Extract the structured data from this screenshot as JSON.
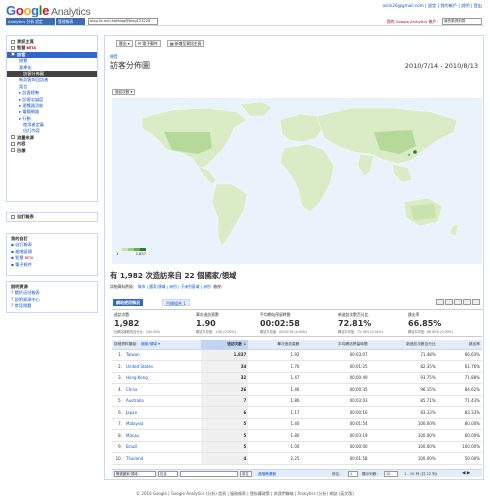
{
  "header": {
    "logo_letters": [
      "G",
      "o",
      "o",
      "g",
      "l",
      "e"
    ],
    "logo_suffix": "Analytics",
    "top_links": "aslin26@gmail.com | 設定 | 我的帳戶 | 說明 | 登出",
    "account_label": "Analytics 分析 設定",
    "account_label2": "管理報表",
    "profile_select": "blog.lic.edu.twfblog@blog123228",
    "right_account": "我的 Google Analytics 帳戶：",
    "right_select": "我的新資料財"
  },
  "sidebar": {
    "nav_items": [
      {
        "label": "資訊主頁",
        "style": "bold"
      },
      {
        "label": "智慧",
        "style": "bold",
        "badge": "BETA"
      },
      {
        "label": "訪客",
        "style": "active"
      },
      {
        "label": "總覽",
        "style": "sub"
      },
      {
        "label": "基準化",
        "style": "sub"
      },
      {
        "label": "訪客分佈圖",
        "style": "activesub"
      },
      {
        "label": "新訪客與回訪者",
        "style": "sub"
      },
      {
        "label": "語言",
        "style": "sub"
      },
      {
        "label": "▸ 訪客趨勢",
        "style": "sub"
      },
      {
        "label": "▸ 訪客忠誠度",
        "style": "sub"
      },
      {
        "label": "▸ 瀏覽器功能",
        "style": "sub"
      },
      {
        "label": "▸ 電腦網路",
        "style": "sub"
      },
      {
        "label": "▸ 行動",
        "style": "sub"
      },
      {
        "label": "使用者定義",
        "style": "sub2"
      },
      {
        "label": "自訂內容",
        "style": "sub2"
      },
      {
        "label": "流量來源",
        "style": "bold"
      },
      {
        "label": "內容",
        "style": "bold"
      },
      {
        "label": "目標",
        "style": "bold"
      }
    ],
    "custom_reports": "自訂報表",
    "my_custom_title": "我的自訂",
    "my_custom_items": [
      {
        "label": "自訂報表",
        "badge": ""
      },
      {
        "label": "進階區隔",
        "badge": ""
      },
      {
        "label": "智慧",
        "badge": "BETA"
      },
      {
        "label": "電子郵件",
        "badge": ""
      }
    ],
    "help_title": "說明資源",
    "help_items": [
      "關於這份報表",
      "說明資源中心",
      "常見問題"
    ]
  },
  "toolbar": {
    "export": "匯出 ▾",
    "email": "電子郵件",
    "add_to_dashboard": "新增至資訊主頁"
  },
  "main": {
    "breadcrumb": "總覽",
    "title": "訪客分佈圖",
    "date_range": "2010/7/14 - 2010/8/13",
    "map_tab": "造訪次數 ▾",
    "legend_min": "1",
    "legend_max": "1,837",
    "summary_prefix": "有 1,982 次造訪來自 22 個國家/領域",
    "dims_label": "詳細資料層級：",
    "dims_links": "城市 | 國家/領域 | 洲別 | 子洲別區域 | 洲別",
    "dims_view": "檢視：",
    "tab_site": "網站使用情況",
    "tab_goal": "目標組合 1"
  },
  "metrics": [
    {
      "label": "造訪次數",
      "value": "1,982",
      "sub": "佔網站總數的百分比：100.00%"
    },
    {
      "label": "單次造訪頁數",
      "value": "1.90",
      "sub": "網站平均值：1.90 (0.00%)"
    },
    {
      "label": "平均網站停留時間",
      "value": "00:02:58",
      "sub": "網站平均值：00:02:58 (0.00%)"
    },
    {
      "label": "新造訪次數百分比",
      "value": "72.81%",
      "sub": "網站平均值：72.78% (0.04%)"
    },
    {
      "label": "跳出率",
      "value": "66.85%",
      "sub": "網站平均值：66.85% (0.00%)"
    }
  ],
  "table": {
    "headers": [
      "詳細資料層級：",
      "國家/領域 ▾",
      "造訪次數 ↓",
      "單次造訪頁數",
      "平均網站停留時間",
      "新造訪次數百分比",
      "跳出率"
    ],
    "rows": [
      {
        "rank": "1.",
        "country": "Taiwan",
        "visits": "1,837",
        "ppv": "1.92",
        "time": "00:03:07",
        "newpct": "71.48%",
        "bounce": "66.63%"
      },
      {
        "rank": "2.",
        "country": "United States",
        "visits": "34",
        "ppv": "1.76",
        "time": "00:01:25",
        "newpct": "82.35%",
        "bounce": "61.76%"
      },
      {
        "rank": "3.",
        "country": "Hong Kong",
        "visits": "32",
        "ppv": "1.47",
        "time": "00:00:49",
        "newpct": "93.75%",
        "bounce": "71.88%"
      },
      {
        "rank": "4.",
        "country": "China",
        "visits": "26",
        "ppv": "1.46",
        "time": "00:00:35",
        "newpct": "96.15%",
        "bounce": "84.62%"
      },
      {
        "rank": "5.",
        "country": "Australia",
        "visits": "7",
        "ppv": "1.86",
        "time": "00:03:03",
        "newpct": "85.71%",
        "bounce": "71.43%"
      },
      {
        "rank": "6.",
        "country": "Japan",
        "visits": "6",
        "ppv": "1.17",
        "time": "00:00:16",
        "newpct": "83.33%",
        "bounce": "83.33%"
      },
      {
        "rank": "7.",
        "country": "Malaysia",
        "visits": "5",
        "ppv": "1.40",
        "time": "00:01:54",
        "newpct": "100.00%",
        "bounce": "80.00%"
      },
      {
        "rank": "8.",
        "country": "Macau",
        "visits": "5",
        "ppv": "1.80",
        "time": "00:03:19",
        "newpct": "100.00%",
        "bounce": "60.00%"
      },
      {
        "rank": "9.",
        "country": "Brazil",
        "visits": "5",
        "ppv": "1.00",
        "time": "00:00:00",
        "newpct": "100.00%",
        "bounce": "100.00%"
      },
      {
        "rank": "10.",
        "country": "Thailand",
        "visits": "4",
        "ppv": "2.25",
        "time": "00:01:58",
        "newpct": "100.00%",
        "bounce": "50.00%"
      }
    ]
  },
  "table_footer": {
    "filter_select": "篩選國家/領域：",
    "filter_mode": "包含",
    "go": "前往",
    "advanced": "進階篩選器",
    "goto_label": "前往：",
    "goto_value": "1",
    "show_rows_label": "顯示列數：",
    "show_rows_value": "10",
    "page_info": "1 - 10 列 (共 22 列)"
  },
  "footer": "© 2010 Google | Google Analytics (分析) 首頁 | 服務條款 | 隱私權政策 | 與我們聯絡 | Analytics (分析) 網誌 (英文版)",
  "colors": {
    "accent": "#3366cc",
    "map_light": "#dcecc8",
    "map_dark": "#2e7d32"
  }
}
